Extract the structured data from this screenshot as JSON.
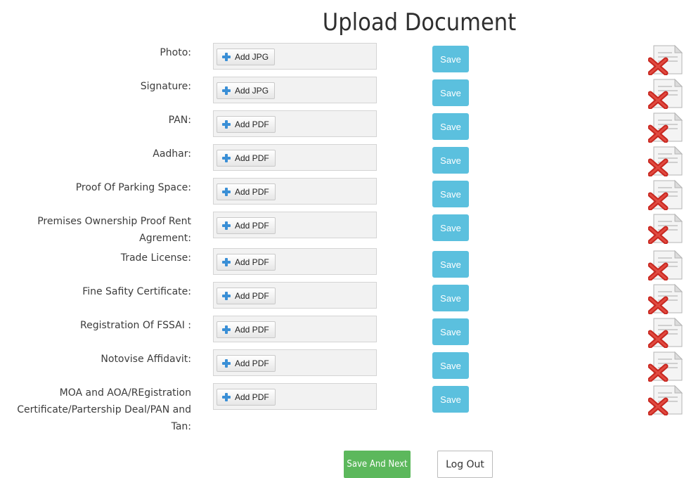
{
  "page": {
    "title": "Upload Document"
  },
  "rows": [
    {
      "label": "Photo:",
      "add_label": "Add JPG",
      "save_label": "Save"
    },
    {
      "label": "Signature:",
      "add_label": "Add JPG",
      "save_label": "Save"
    },
    {
      "label": "PAN:",
      "add_label": "Add PDF",
      "save_label": "Save"
    },
    {
      "label": "Aadhar:",
      "add_label": "Add PDF",
      "save_label": "Save"
    },
    {
      "label": "Proof Of Parking Space:",
      "add_label": "Add PDF",
      "save_label": "Save"
    },
    {
      "label": "Premises Ownership Proof Rent Agrement:",
      "add_label": "Add PDF",
      "save_label": "Save"
    },
    {
      "label": "Trade License:",
      "add_label": "Add PDF",
      "save_label": "Save"
    },
    {
      "label": "Fine Safity Certificate:",
      "add_label": "Add PDF",
      "save_label": "Save"
    },
    {
      "label": "Registration Of FSSAI :",
      "add_label": "Add PDF",
      "save_label": "Save"
    },
    {
      "label": "Notovise Affidavit:",
      "add_label": "Add PDF",
      "save_label": "Save"
    },
    {
      "label": "MOA and AOA/REgistration Certificate/Partership Deal/PAN and Tan:",
      "add_label": "Add PDF",
      "save_label": "Save"
    }
  ],
  "icons": {
    "add": "plus-icon",
    "delete": "delete-document-icon"
  },
  "actions": {
    "save_next_label": "Save And Next",
    "logout_label": "Log Out"
  },
  "colors": {
    "save_button": "#5bc0de",
    "save_next_button": "#5cb85c",
    "delete_x": "#d9322b",
    "add_plus": "#3a8fd6"
  }
}
